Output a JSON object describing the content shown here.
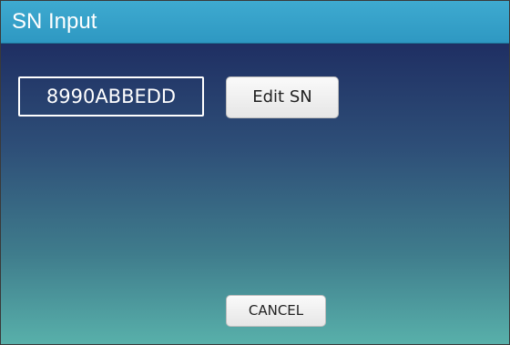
{
  "window": {
    "title": "SN Input"
  },
  "sn_field": {
    "value": "8990ABBEDD"
  },
  "buttons": {
    "edit_label": "Edit SN",
    "cancel_label": "CANCEL"
  }
}
